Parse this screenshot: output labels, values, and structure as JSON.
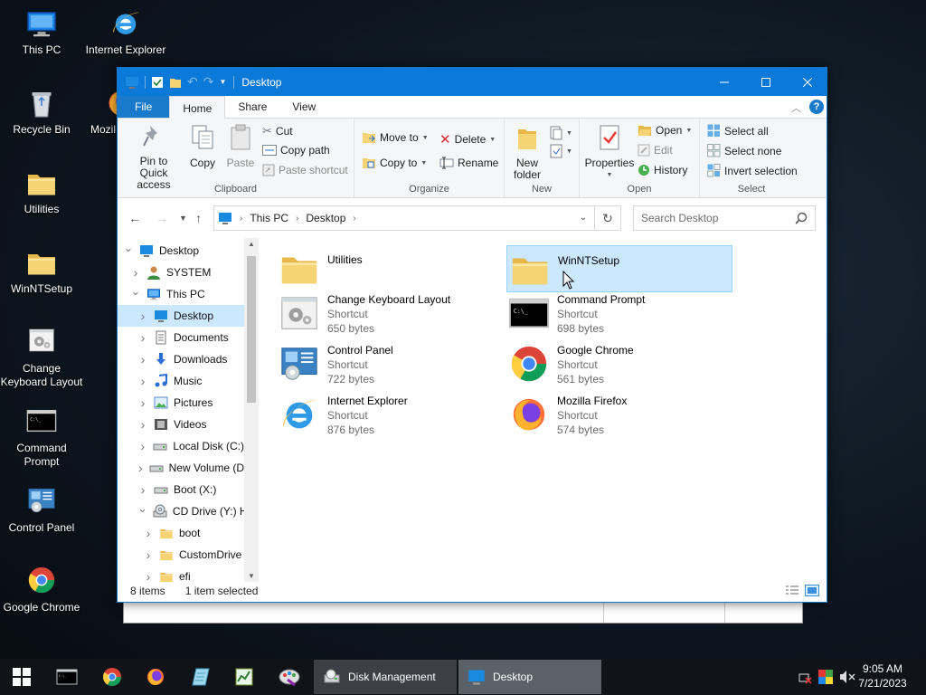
{
  "desktop_icons": [
    {
      "label": "This PC",
      "icon": "this-pc-icon"
    },
    {
      "label": "Internet Explorer",
      "icon": "internet-explorer-icon"
    },
    {
      "label": "Recycle Bin",
      "icon": "recycle-bin-icon"
    },
    {
      "label": "Mozil",
      "icon": "firefox-icon"
    },
    {
      "label": "Utilities",
      "icon": "folder-icon"
    },
    {
      "label": "WinNTSetup",
      "icon": "folder-icon"
    },
    {
      "label": "Change Keyboard Layout",
      "icon": "keyboard-settings-icon"
    },
    {
      "label": "Command Prompt",
      "icon": "command-prompt-icon"
    },
    {
      "label": "Control Panel",
      "icon": "control-panel-icon"
    },
    {
      "label": "Google Chrome",
      "icon": "chrome-icon"
    }
  ],
  "window": {
    "title": "Desktop",
    "tabs": {
      "file": "File",
      "home": "Home",
      "share": "Share",
      "view": "View"
    },
    "ribbon": {
      "clipboard": {
        "label": "Clipboard",
        "pin": "Pin to Quick access",
        "copy": "Copy",
        "paste": "Paste",
        "cut": "Cut",
        "copy_path": "Copy path",
        "paste_shortcut": "Paste shortcut"
      },
      "organize": {
        "label": "Organize",
        "move_to": "Move to",
        "copy_to": "Copy to",
        "delete": "Delete",
        "rename": "Rename"
      },
      "new": {
        "label": "New",
        "new_folder": "New folder"
      },
      "open": {
        "label": "Open",
        "properties": "Properties",
        "open": "Open",
        "edit": "Edit",
        "history": "History"
      },
      "select": {
        "label": "Select",
        "select_all": "Select all",
        "select_none": "Select none",
        "invert": "Invert selection"
      }
    },
    "address": {
      "crumbs": [
        "This PC",
        "Desktop"
      ]
    },
    "search": {
      "placeholder": "Search Desktop"
    },
    "nav": [
      {
        "label": "Desktop",
        "icon": "desktop-icon",
        "depth": 0,
        "expanded": true,
        "selected": false
      },
      {
        "label": "SYSTEM",
        "icon": "user-icon",
        "depth": 1,
        "expanded": false,
        "selected": false
      },
      {
        "label": "This PC",
        "icon": "this-pc-icon",
        "depth": 1,
        "expanded": true,
        "selected": false
      },
      {
        "label": "Desktop",
        "icon": "desktop-icon",
        "depth": 2,
        "expanded": false,
        "selected": true
      },
      {
        "label": "Documents",
        "icon": "documents-icon",
        "depth": 2,
        "expanded": false,
        "selected": false
      },
      {
        "label": "Downloads",
        "icon": "downloads-icon",
        "depth": 2,
        "expanded": false,
        "selected": false
      },
      {
        "label": "Music",
        "icon": "music-icon",
        "depth": 2,
        "expanded": false,
        "selected": false
      },
      {
        "label": "Pictures",
        "icon": "pictures-icon",
        "depth": 2,
        "expanded": false,
        "selected": false
      },
      {
        "label": "Videos",
        "icon": "videos-icon",
        "depth": 2,
        "expanded": false,
        "selected": false
      },
      {
        "label": "Local Disk (C:)",
        "icon": "drive-icon",
        "depth": 2,
        "expanded": false,
        "selected": false
      },
      {
        "label": "New Volume (D",
        "icon": "drive-icon",
        "depth": 2,
        "expanded": false,
        "selected": false
      },
      {
        "label": "Boot (X:)",
        "icon": "drive-icon",
        "depth": 2,
        "expanded": false,
        "selected": false
      },
      {
        "label": "CD Drive (Y:) H",
        "icon": "cd-drive-icon",
        "depth": 2,
        "expanded": true,
        "selected": false
      },
      {
        "label": "boot",
        "icon": "folder-icon",
        "depth": 3,
        "expanded": false,
        "selected": false
      },
      {
        "label": "CustomDrive",
        "icon": "folder-icon",
        "depth": 3,
        "expanded": false,
        "selected": false
      },
      {
        "label": "efi",
        "icon": "folder-icon",
        "depth": 3,
        "expanded": false,
        "selected": false
      }
    ],
    "files": [
      {
        "name": "Utilities",
        "type": "",
        "size": "",
        "icon": "folder-icon",
        "selected": false
      },
      {
        "name": "WinNTSetup",
        "type": "",
        "size": "",
        "icon": "folder-icon",
        "selected": true
      },
      {
        "name": "Change Keyboard Layout",
        "type": "Shortcut",
        "size": "650 bytes",
        "icon": "keyboard-settings-icon",
        "selected": false
      },
      {
        "name": "Command Prompt",
        "type": "Shortcut",
        "size": "698 bytes",
        "icon": "command-prompt-icon",
        "selected": false
      },
      {
        "name": "Control Panel",
        "type": "Shortcut",
        "size": "722 bytes",
        "icon": "control-panel-icon",
        "selected": false
      },
      {
        "name": "Google Chrome",
        "type": "Shortcut",
        "size": "561 bytes",
        "icon": "chrome-icon",
        "selected": false
      },
      {
        "name": "Internet Explorer",
        "type": "Shortcut",
        "size": "876 bytes",
        "icon": "internet-explorer-icon",
        "selected": false
      },
      {
        "name": "Mozilla Firefox",
        "type": "Shortcut",
        "size": "574 bytes",
        "icon": "firefox-icon",
        "selected": false
      }
    ],
    "status": {
      "items": "8 items",
      "selected": "1 item selected"
    }
  },
  "taskbar": {
    "pinned": [
      "start-icon",
      "command-prompt-icon",
      "chrome-icon",
      "firefox-icon",
      "notepad-icon",
      "task-manager-icon",
      "paint-icon"
    ],
    "buttons": [
      {
        "label": "Disk Management",
        "icon": "disk-management-icon",
        "active": false
      },
      {
        "label": "Desktop",
        "icon": "desktop-icon",
        "active": true
      }
    ],
    "time": "9:05 AM",
    "date": "7/21/2023"
  },
  "colors": {
    "titlebar": "#0a79d8",
    "selection": "#cce8ff",
    "selection_border": "#99d1ff",
    "taskbar": "#101419"
  }
}
